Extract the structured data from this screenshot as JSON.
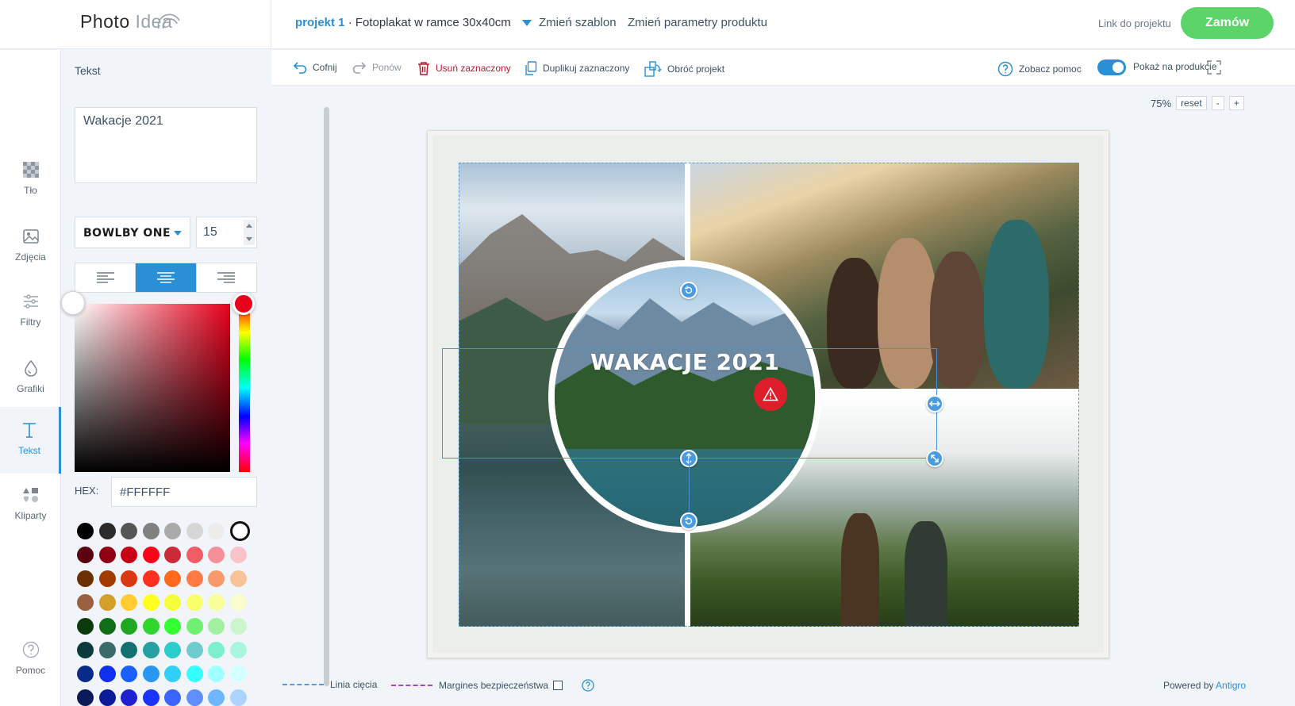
{
  "header": {
    "logo_main": "Photo",
    "logo_light": "Idea",
    "project_name": "projekt 1",
    "project_desc": " · Fotoplakat w ramce 30x40cm",
    "change_template": "Zmień szablon",
    "change_params": "Zmień parametry produktu",
    "project_link": "Link do projektu",
    "order_button": "Zamów"
  },
  "rail": [
    {
      "label": "Tło",
      "icon": "checker-icon"
    },
    {
      "label": "Zdjęcia",
      "icon": "image-icon"
    },
    {
      "label": "Filtry",
      "icon": "sliders-icon"
    },
    {
      "label": "Grafiki",
      "icon": "drop-icon"
    },
    {
      "label": "Tekst",
      "icon": "text-icon"
    },
    {
      "label": "Kliparty",
      "icon": "shapes-icon"
    },
    {
      "label": "Pomoc",
      "icon": "help-icon"
    }
  ],
  "panel": {
    "title": "Tekst",
    "text_value": "Wakacje 2021",
    "font_name": "BOWLBY ONE",
    "font_size": "15",
    "hex_label": "HEX:",
    "hex_value": "#FFFFFF",
    "selected_color": "#FFFFFF",
    "swatch_rows": [
      [
        "#000000",
        "#2b2b2b",
        "#555555",
        "#808080",
        "#aaaaaa",
        "#d6d6d6",
        "#ececec",
        "#ffffff"
      ],
      [
        "#5c0010",
        "#8f0012",
        "#c80016",
        "#ff0018",
        "#cc2a36",
        "#f25c65",
        "#f5909a",
        "#f8c4ca"
      ],
      [
        "#6b3000",
        "#a33a00",
        "#d93810",
        "#ff3020",
        "#ff6a1a",
        "#ff7a45",
        "#f79a6b",
        "#f7c49a"
      ],
      [
        "#9a6040",
        "#d4a02a",
        "#ffcd30",
        "#ffff20",
        "#f4ff3a",
        "#f8ff6a",
        "#f8ff9a",
        "#fafccc"
      ],
      [
        "#0b3a0b",
        "#0f6e16",
        "#1ea820",
        "#2ed62e",
        "#33ff33",
        "#70f070",
        "#a0f0a0",
        "#ccf5cc"
      ],
      [
        "#0a3a3a",
        "#3a6a6a",
        "#137070",
        "#26a0a0",
        "#2acccc",
        "#70cccc",
        "#7cf0cc",
        "#aaf5dd"
      ],
      [
        "#0a2a8a",
        "#1030f0",
        "#1a60ff",
        "#2a96f0",
        "#30cff5",
        "#33ffff",
        "#a0ffff",
        "#d4ffff"
      ],
      [
        "#0a1a5a",
        "#0a1c9a",
        "#2020d0",
        "#1a33ff",
        "#3a66ff",
        "#5f8fff",
        "#6fb5ff",
        "#aad4ff"
      ]
    ]
  },
  "toolbar": {
    "undo": "Cofnij",
    "redo": "Ponów",
    "delete": "Usuń zaznaczony",
    "duplicate": "Duplikuj zaznaczony",
    "rotate": "Obróć projekt",
    "help": "Zobacz pomoc",
    "show_on_product": "Pokaż na produkcie"
  },
  "canvas": {
    "zoom": "75%",
    "reset": "reset",
    "zoom_out": "-",
    "zoom_in": "+",
    "overlay_text": "WAKACJE 2021"
  },
  "footer": {
    "cut_line": "Linia cięcia",
    "safety_margin": "Margines bezpieczeństwa",
    "powered_by": "Powered by ",
    "powered_brand": "Antigro"
  },
  "colors": {
    "accent": "#2b8fd6",
    "order_green": "#5cd46a",
    "danger": "#b21d2e",
    "picker_hue": "#e8001b"
  }
}
